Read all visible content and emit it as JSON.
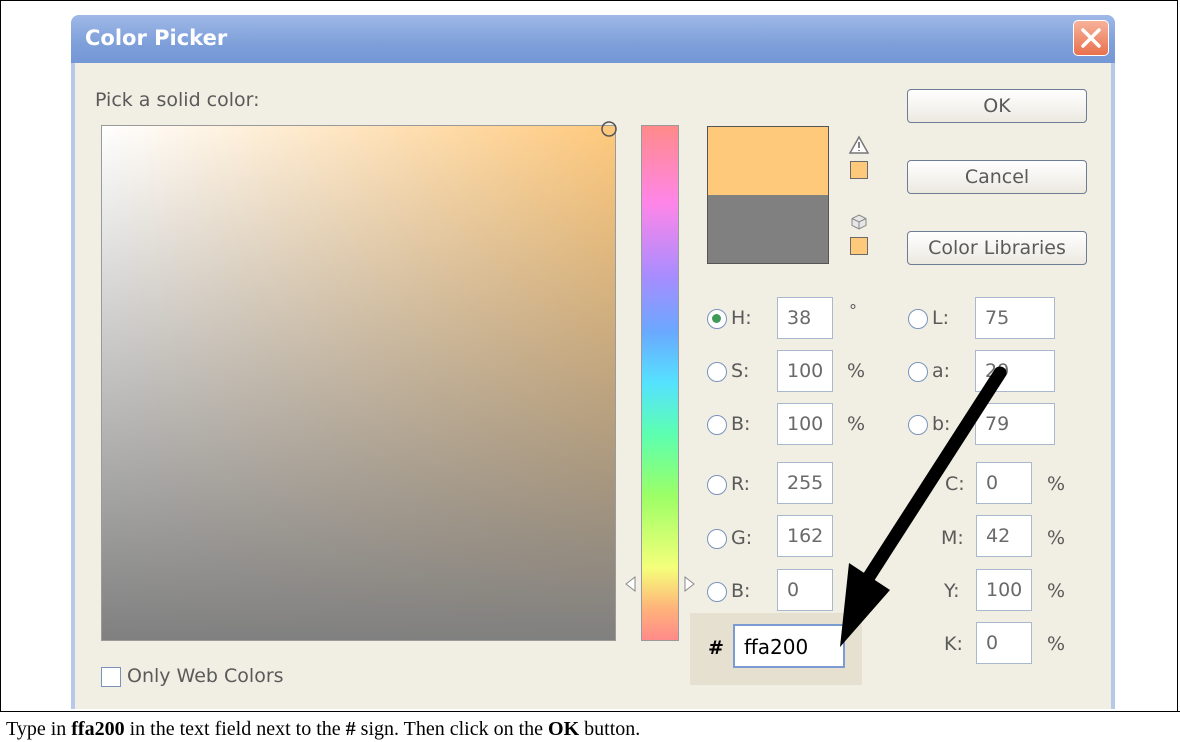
{
  "dialog": {
    "title": "Color Picker",
    "pick_label": "Pick a solid color:",
    "ok_label": "OK",
    "cancel_label": "Cancel",
    "libraries_label": "Color Libraries",
    "only_web_label": "Only Web Colors",
    "hex_label": "#",
    "hex_value": "ffa200",
    "fields": {
      "h": {
        "label": "H:",
        "value": "38",
        "unit": "°"
      },
      "s": {
        "label": "S:",
        "value": "100",
        "unit": "%"
      },
      "b": {
        "label": "B:",
        "value": "100",
        "unit": "%"
      },
      "r": {
        "label": "R:",
        "value": "255"
      },
      "g": {
        "label": "G:",
        "value": "162"
      },
      "b2": {
        "label": "B:",
        "value": "0"
      },
      "l": {
        "label": "L:",
        "value": "75"
      },
      "a": {
        "label": "a:",
        "value": "29"
      },
      "lab_b": {
        "label": "b:",
        "value": "79"
      },
      "c": {
        "label": "C:",
        "value": "0",
        "unit": "%"
      },
      "m": {
        "label": "M:",
        "value": "42",
        "unit": "%"
      },
      "y": {
        "label": "Y:",
        "value": "100",
        "unit": "%"
      },
      "k": {
        "label": "K:",
        "value": "0",
        "unit": "%"
      }
    },
    "selected_mode": "H",
    "colors": {
      "new_color": "#ffc97c",
      "current_color": "#808080",
      "field_hue": "#ffc97c"
    },
    "icons": {
      "warning": "warning-icon",
      "web_safe": "cube-icon",
      "close": "close-icon"
    }
  },
  "caption": {
    "before": "Type in ",
    "value_bold": "ffa200",
    "middle": " in the text field next to the ",
    "sign_bold": "#",
    "after_sign": " sign. Then click on the ",
    "button_bold": "OK",
    "end": " button."
  }
}
